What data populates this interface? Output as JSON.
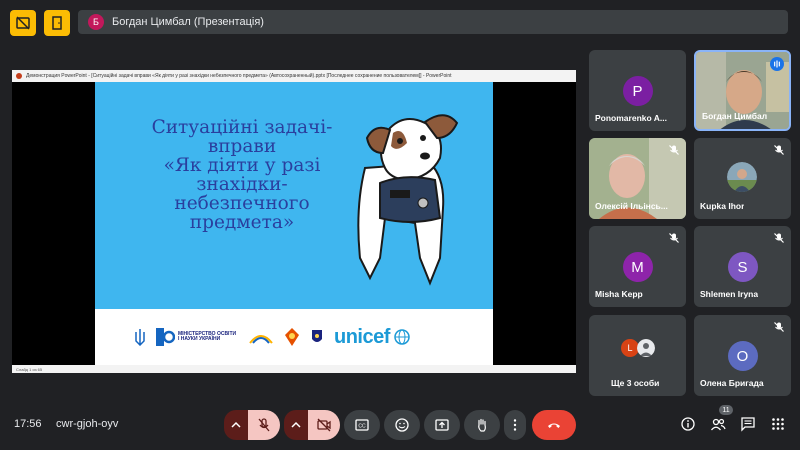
{
  "banner": {
    "avatar_letter": "Б",
    "avatar_color": "#c2185b",
    "text": "Богдан Цимбал (Презентація)"
  },
  "presentation": {
    "window_title": "Демонстрация PowerPoint - [Ситуаційні задачі вправи «Як діяти у разі знахідки небезпечного предмета» (Автосохраненный).pptx [Последнее сохранение пользователем]] - PowerPoint",
    "status_text": "Слайд 1 из 65",
    "slide": {
      "title_lines": [
        "Ситуаційні задачі-",
        "вправи",
        "«Як діяти  у разі",
        "знахідки-",
        "небезпечного",
        "предмета»"
      ],
      "ministry_text": "МІНІСТЕРСТВО ОСВІТИ І НАУКИ УКРАЇНИ",
      "unicef_text": "unicef"
    }
  },
  "participants": [
    {
      "name": "Ponomarenko A...",
      "letter": "P",
      "color": "#7b1fa2",
      "muted": false
    },
    {
      "name": "Богдан Цимбал",
      "speaking": true
    },
    {
      "name": "Олексій Ільінсь...",
      "muted": true
    },
    {
      "name": "Kupka Ihor",
      "muted": true
    },
    {
      "name": "Misha Kepp",
      "letter": "M",
      "color": "#8e24aa",
      "muted": true
    },
    {
      "name": "Shlemen Iryna",
      "letter": "S",
      "color": "#7e57c2",
      "muted": true
    },
    {
      "name": "Ще 3 особи",
      "letters": [
        "L"
      ],
      "color": "#d84315"
    },
    {
      "name": "Олена Бригада",
      "letter": "O",
      "color": "#5c6bc0",
      "muted": true
    }
  ],
  "bottom": {
    "time": "17:56",
    "meeting_code": "cwr-gjoh-oyv",
    "participant_count": "11"
  },
  "colors": {
    "accent_red": "#ea4335",
    "muted_red_bg": "#f5c6c2",
    "slide_blue": "#3fb6ef"
  }
}
